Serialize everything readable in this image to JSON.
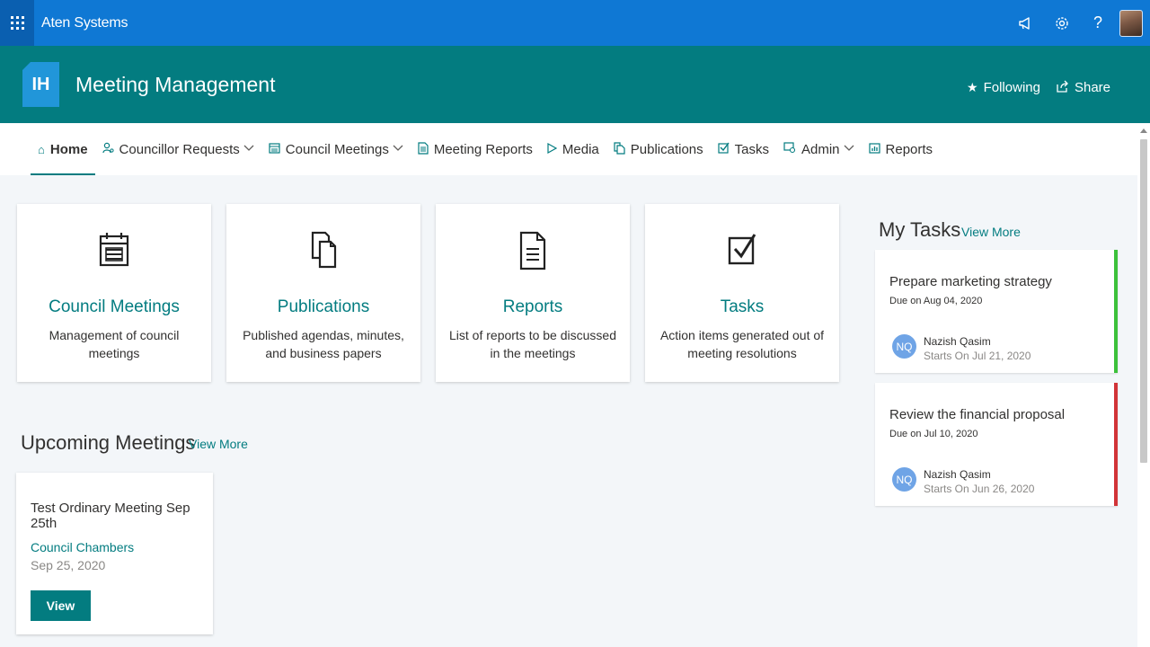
{
  "suite": {
    "title": "Aten Systems",
    "icons": [
      "megaphone-icon",
      "gear-icon",
      "help-icon",
      "user-avatar"
    ]
  },
  "site": {
    "logo_text": "IH",
    "title": "Meeting Management",
    "following_label": "Following",
    "share_label": "Share"
  },
  "nav": {
    "items": [
      {
        "label": "Home",
        "icon": "home-icon",
        "active": true,
        "dropdown": false
      },
      {
        "label": "Councillor Requests",
        "icon": "person-icon",
        "active": false,
        "dropdown": true
      },
      {
        "label": "Council Meetings",
        "icon": "calendar-icon",
        "active": false,
        "dropdown": true
      },
      {
        "label": "Meeting Reports",
        "icon": "document-icon",
        "active": false,
        "dropdown": false
      },
      {
        "label": "Media",
        "icon": "play-icon",
        "active": false,
        "dropdown": false
      },
      {
        "label": "Publications",
        "icon": "copy-icon",
        "active": false,
        "dropdown": false
      },
      {
        "label": "Tasks",
        "icon": "checkbox-icon",
        "active": false,
        "dropdown": false
      },
      {
        "label": "Admin",
        "icon": "admin-icon",
        "active": false,
        "dropdown": true
      },
      {
        "label": "Reports",
        "icon": "chart-icon",
        "active": false,
        "dropdown": false
      }
    ]
  },
  "quick_links": [
    {
      "title": "Council Meetings",
      "description": "Management of council meetings",
      "icon": "calendar-icon"
    },
    {
      "title": "Publications",
      "description": "Published agendas, minutes, and business papers",
      "icon": "copy-icon"
    },
    {
      "title": "Reports",
      "description": "List of reports to be discussed in the meetings",
      "icon": "document-icon"
    },
    {
      "title": "Tasks",
      "description": "Action items generated out of meeting resolutions",
      "icon": "checkbox-icon"
    }
  ],
  "upcoming": {
    "title": "Upcoming Meetings",
    "view_more": "View More",
    "meetings": [
      {
        "title": "Test Ordinary Meeting Sep 25th",
        "location": "Council Chambers",
        "date": "Sep 25, 2020",
        "button": "View"
      }
    ]
  },
  "tasks": {
    "title": "My Tasks",
    "view_more": "View More",
    "items": [
      {
        "title": "Prepare marketing strategy",
        "due": "Due on Aug 04, 2020",
        "initials": "NQ",
        "person": "Nazish Qasim",
        "starts": "Starts On Jul 21, 2020",
        "status_color": "#3cc13b"
      },
      {
        "title": "Review the financial proposal",
        "due": "Due on Jul 10, 2020",
        "initials": "NQ",
        "person": "Nazish Qasim",
        "starts": "Starts On Jun 26, 2020",
        "status_color": "#d13438"
      }
    ]
  },
  "colors": {
    "suite_bar": "#0f78d4",
    "theme": "#037c80",
    "logo": "#2196d9"
  }
}
